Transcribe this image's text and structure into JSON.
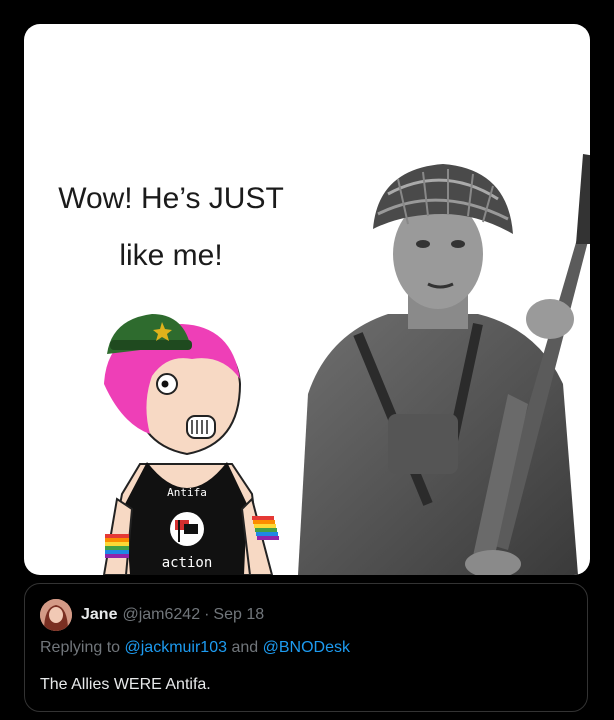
{
  "meme": {
    "caption_line1": "Wow! He’s JUST",
    "caption_line2": "like me!",
    "shirt_text_top": "Antifa",
    "shirt_text_bottom": "action"
  },
  "tweet": {
    "display_name": "Jane",
    "handle": "@jam6242",
    "separator": "·",
    "date": "Sep 18",
    "replying_prefix": "Replying to",
    "reply_mention_1": "@jackmuir103",
    "reply_conjunction": "and",
    "reply_mention_2": "@BNODesk",
    "text": "The Allies WERE Antifa."
  },
  "colors": {
    "background": "#000000",
    "mention_blue": "#1d9bf0",
    "muted_gray": "#71767b",
    "text_light": "#e7e9ea"
  }
}
